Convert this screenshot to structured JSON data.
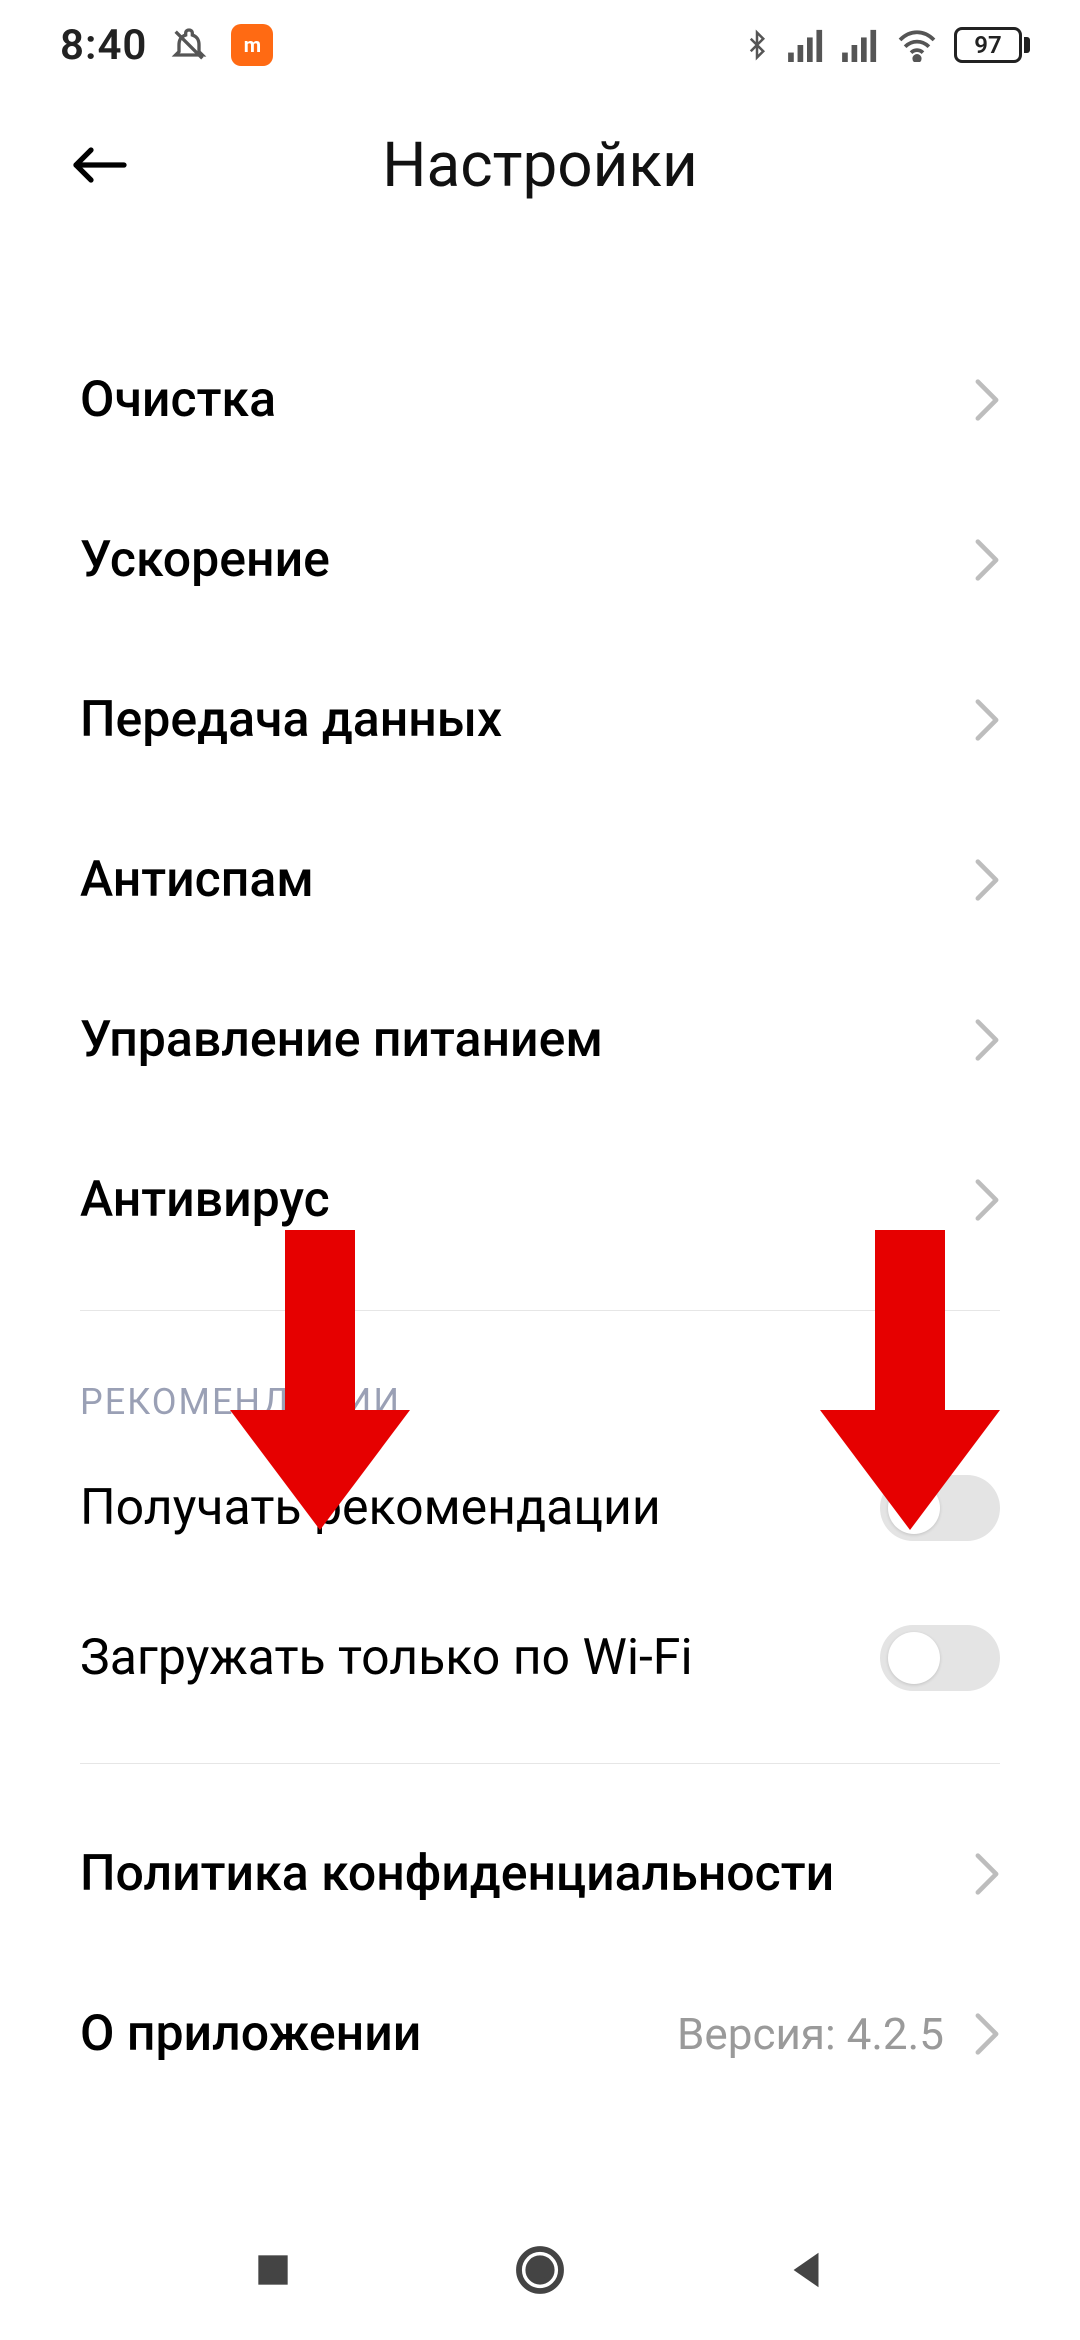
{
  "status": {
    "time": "8:40",
    "battery_pct": "97"
  },
  "header": {
    "title": "Настройки"
  },
  "rows": {
    "clean": "Очистка",
    "boost": "Ускорение",
    "data": "Передача данных",
    "antispam": "Антиспам",
    "power": "Управление питанием",
    "antivirus": "Антивирус"
  },
  "section_recs": "РЕКОМЕНДАЦИИ",
  "toggles": {
    "recommendations_label": "Получать рекомендации",
    "wifi_only_label": "Загружать только по Wi-Fi",
    "recommendations_on": false,
    "wifi_only_on": false
  },
  "footer_rows": {
    "privacy": "Политика конфиденциальности",
    "about": "О приложении",
    "version_label": "Версия: 4.2.5"
  },
  "annotations": {
    "arrow_color": "#e60000"
  }
}
